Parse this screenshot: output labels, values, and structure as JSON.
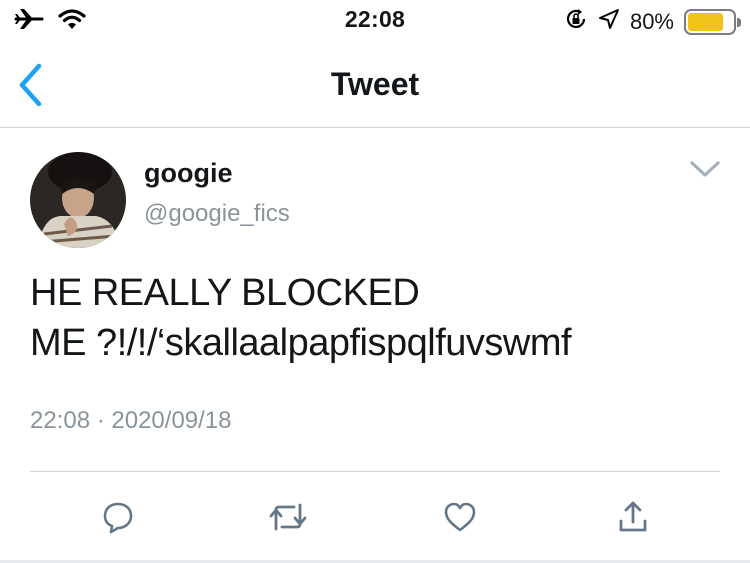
{
  "status_bar": {
    "time": "22:08",
    "battery_percent": "80%",
    "battery_level": 0.8,
    "left_icons": [
      "airplane-icon",
      "wifi-icon"
    ],
    "right_icons": [
      "rotation-lock-icon",
      "location-arrow-icon"
    ]
  },
  "nav": {
    "title": "Tweet",
    "back_icon": "chevron-left-icon"
  },
  "tweet": {
    "display_name": "googie",
    "handle": "@googie_fics",
    "text_lines": [
      "HE REALLY BLOCKED",
      "ME ?!/!/‘skallaalpapfispqlfuvswmf"
    ],
    "timestamp": "22:08 · 2020/09/18",
    "more_icon": "chevron-down-icon"
  },
  "actions": [
    {
      "name": "reply",
      "icon": "reply-bubble-icon"
    },
    {
      "name": "retweet",
      "icon": "retweet-icon"
    },
    {
      "name": "like",
      "icon": "heart-icon"
    },
    {
      "name": "share",
      "icon": "share-icon"
    }
  ],
  "colors": {
    "accent": "#1da1f2",
    "text": "#14171a",
    "secondary_text": "#8a949d",
    "icon_gray": "#657786",
    "battery": "#f0c419"
  }
}
